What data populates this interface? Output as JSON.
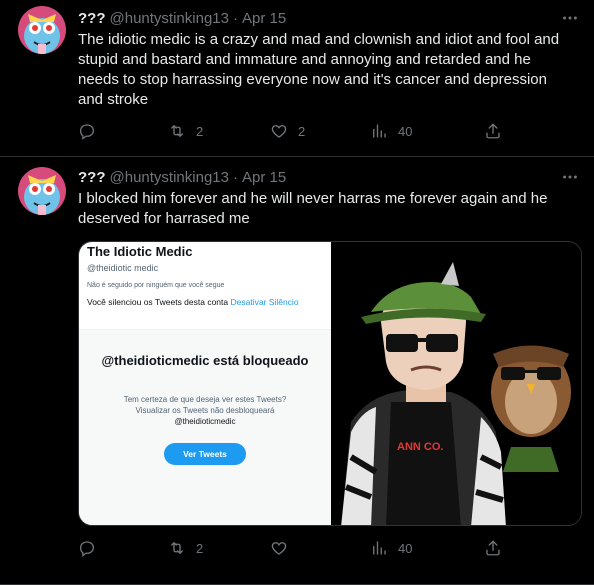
{
  "tweets": [
    {
      "display_name": "???",
      "handle": "@huntystinking13",
      "separator": "·",
      "date": "Apr 15",
      "text": "The idiotic medic is a crazy and mad and clownish and idiot and fool and\nstupid and bastard and immature and annoying and retarded and he\nneeds to stop harrassing everyone now and it's cancer and depression\nand stroke",
      "actions": {
        "replies": "",
        "retweets": "2",
        "likes": "2",
        "views": "40"
      }
    },
    {
      "display_name": "???",
      "handle": "@huntystinking13",
      "separator": "·",
      "date": "Apr 15",
      "text": "I blocked him forever and he will never harras me forever again and he\ndeserved for harrased me",
      "actions": {
        "replies": "",
        "retweets": "2",
        "likes": "",
        "views": "40"
      },
      "media": {
        "screenshot": {
          "profile_name": "The Idiotic Medic",
          "profile_handle": "@theidiotic medic",
          "follow_note": "Não é seguido por ninguém que você segue",
          "silenced_text": "Você silenciou os Tweets desta conta",
          "silenced_link": "Desativar Silêncio",
          "blocked_title": "@theidioticmedic está bloqueado",
          "question_line1": "Tem certeza de que deseja ver estes Tweets?",
          "question_line2": "Visualizar os Tweets não desbloqueará",
          "question_handle": "@theidioticmedic",
          "button_label": "Ver Tweets"
        },
        "art_shirt_text": "ANN CO."
      }
    }
  ],
  "icons": {
    "more": "more-horizontal-icon",
    "reply": "reply-icon",
    "retweet": "retweet-icon",
    "like": "heart-icon",
    "views": "views-chart-icon",
    "share": "share-icon"
  },
  "colors": {
    "background": "#000000",
    "text": "#e7e9ea",
    "muted": "#71767b",
    "border": "#2f3336",
    "accent": "#1d9bf0"
  }
}
